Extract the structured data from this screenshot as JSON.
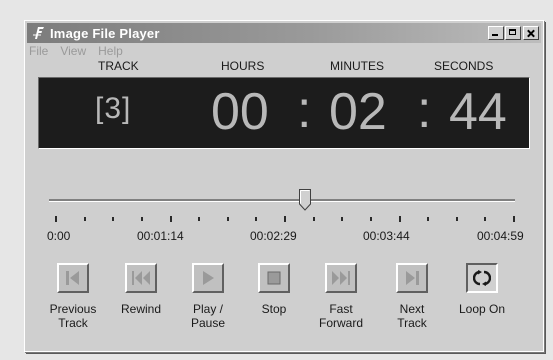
{
  "window": {
    "title": "Image File Player"
  },
  "menu": {
    "items": [
      {
        "label": "File"
      },
      {
        "label": "View"
      },
      {
        "label": "Help"
      }
    ]
  },
  "display": {
    "headers": {
      "track": "TRACK",
      "hours": "HOURS",
      "minutes": "MINUTES",
      "seconds": "SECONDS"
    },
    "track_number": "[3]",
    "hours": "00",
    "minutes": "02",
    "seconds": "44",
    "separator": ":"
  },
  "timeline": {
    "position_fraction": 0.545,
    "labels": [
      "0:00",
      "00:01:14",
      "00:02:29",
      "00:03:44",
      "00:04:59"
    ]
  },
  "controls": [
    {
      "label_line1": "Previous",
      "label_line2": "Track",
      "icon": "previous-track-icon"
    },
    {
      "label_line1": "Rewind",
      "label_line2": "",
      "icon": "rewind-icon"
    },
    {
      "label_line1": "Play /",
      "label_line2": "Pause",
      "icon": "play-icon"
    },
    {
      "label_line1": "Stop",
      "label_line2": "",
      "icon": "stop-icon"
    },
    {
      "label_line1": "Fast",
      "label_line2": "Forward",
      "icon": "fast-forward-icon"
    },
    {
      "label_line1": "Next",
      "label_line2": "Track",
      "icon": "next-track-icon"
    },
    {
      "label_line1": "Loop On",
      "label_line2": "",
      "icon": "loop-icon"
    }
  ],
  "colors": {
    "display_bg": "#1c1c1c",
    "display_digits": "#b8b8b8",
    "window_face": "#cfcfcf",
    "icon_grey": "#9a9a9a"
  }
}
